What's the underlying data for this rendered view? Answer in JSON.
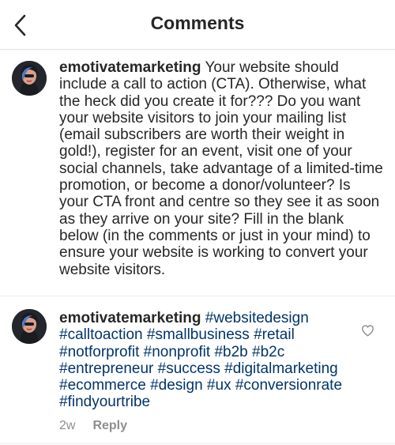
{
  "header": {
    "title": "Comments",
    "back_icon": "chevron-left-icon"
  },
  "caption": {
    "username": "emotivatemarketing",
    "text": "Your website should include a call to action (CTA). Otherwise, what the heck did you create it for??? Do you want your website visitors to join your mailing list (email subscribers are worth their weight in gold!), register for an event, visit one of your social channels, take advantage of a limited-time promotion, or become  a donor/volunteer? Is your CTA front and centre so they see it as soon as they arrive on your site? Fill in the blank below (in the comments or just in your mind) to ensure your website is working to convert your website visitors."
  },
  "comments": [
    {
      "username": "emotivatemarketing",
      "text": "#websitedesign #calltoaction #smallbusiness #retail #notforprofit #nonprofit #b2b #b2c #entrepreneur #success #digitalmarketing #ecommerce #design #ux #conversionrate #findyourtribe",
      "time": "2w",
      "reply_label": "Reply",
      "like_icon": "heart-outline-icon"
    }
  ],
  "colors": {
    "text": "#262626",
    "hashtag": "#003569",
    "meta": "#8e8e8e",
    "divider": "#efefef"
  }
}
